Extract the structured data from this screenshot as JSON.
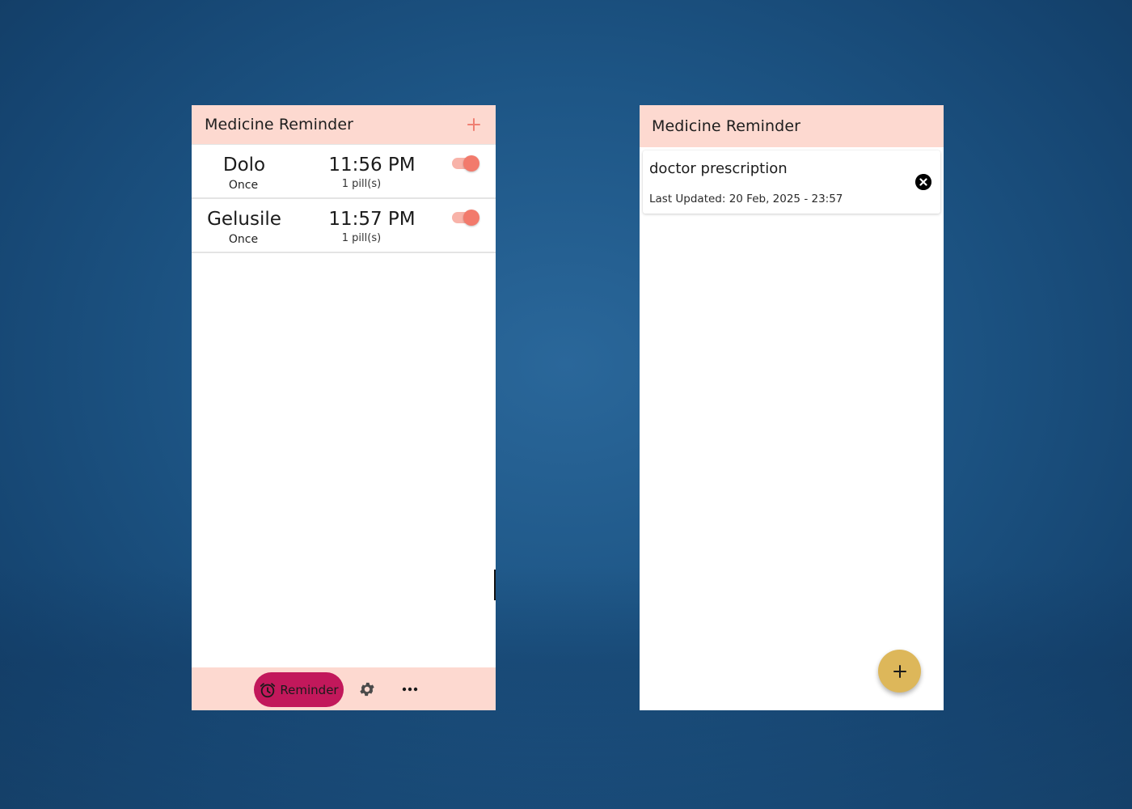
{
  "left_screen": {
    "appbar": {
      "title": "Medicine Reminder",
      "add_icon": "plus-icon",
      "accent": "#ef7f72"
    },
    "reminders": [
      {
        "name": "Dolo",
        "frequency": "Once",
        "time": "11:56 PM",
        "dose": "1 pill(s)",
        "enabled": true
      },
      {
        "name": "Gelusile",
        "frequency": "Once",
        "time": "11:57 PM",
        "dose": "1 pill(s)",
        "enabled": true
      }
    ],
    "bottom_nav": {
      "active_label": "Reminder",
      "active_icon": "alarm-clock-icon",
      "settings_icon": "gear-icon",
      "more_icon": "more-horizontal-icon",
      "active_color": "#c2185b"
    }
  },
  "right_screen": {
    "appbar": {
      "title": "Medicine Reminder"
    },
    "notes": [
      {
        "title": "doctor prescription",
        "updated": "Last Updated: 20 Feb, 2025 - 23:57"
      }
    ],
    "fab_icon": "plus-icon",
    "fab_color": "#ddb75a"
  },
  "colors": {
    "appbar_bg": "#fdd9d0",
    "toggle_on": "#f27a6c"
  }
}
